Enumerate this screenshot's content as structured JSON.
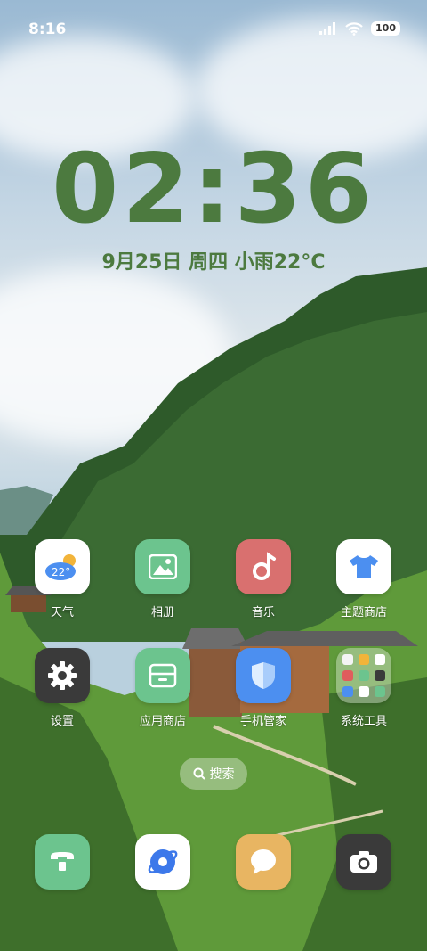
{
  "status_bar": {
    "time": "8:16",
    "battery": "100"
  },
  "lock_clock": {
    "time": "02:36",
    "date": "9月25日 周四 小雨22°C"
  },
  "weather_widget_temp": "22°",
  "apps": [
    {
      "label": "天气"
    },
    {
      "label": "相册"
    },
    {
      "label": "音乐"
    },
    {
      "label": "主题商店"
    },
    {
      "label": "设置"
    },
    {
      "label": "应用商店"
    },
    {
      "label": "手机管家"
    },
    {
      "label": "系统工具"
    }
  ],
  "search": {
    "label": "搜索"
  },
  "colors": {
    "clock": "#4c7a3f",
    "weather_bg": "#ffffff",
    "gallery_bg": "#6cc48e",
    "music_bg": "#d9706f",
    "theme_bg": "#ffffff",
    "settings_bg": "#3a3a3a",
    "appstore_bg": "#6cc48e",
    "security_bg": "#4c8ff0"
  }
}
